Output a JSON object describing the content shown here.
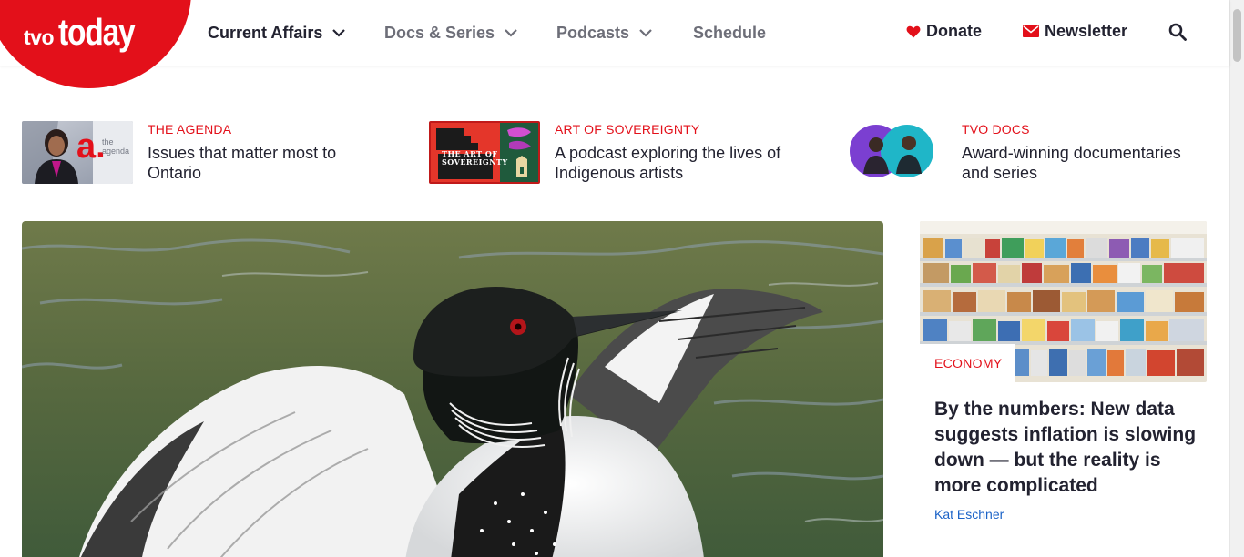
{
  "brand": {
    "tvo": "tvo",
    "today": "today",
    "color": "#e3101a"
  },
  "nav": {
    "items": [
      {
        "label": "Current Affairs",
        "has_dropdown": true,
        "state": "active"
      },
      {
        "label": "Docs & Series",
        "has_dropdown": true,
        "state": "inactive"
      },
      {
        "label": "Podcasts",
        "has_dropdown": true,
        "state": "inactive"
      },
      {
        "label": "Schedule",
        "has_dropdown": false,
        "state": "inactive"
      }
    ],
    "donate": {
      "label": "Donate",
      "icon": "heart-icon"
    },
    "newsletter": {
      "label": "Newsletter",
      "icon": "envelope-icon"
    },
    "search": {
      "icon": "search-icon"
    }
  },
  "promos": [
    {
      "kicker": "THE AGENDA",
      "title": "Issues that matter most to Ontario"
    },
    {
      "kicker": "ART OF SOVEREIGNTY",
      "title": "A podcast exploring the lives of Indigenous artists"
    },
    {
      "kicker": "TVO DOCS",
      "title": "Award-winning documentaries and series"
    }
  ],
  "promo_thumb_text": {
    "agenda_logo": "a.",
    "agenda_small": "the agenda",
    "sovereignty_logo": "THE ART OF SOVEREIGNTY"
  },
  "side_story": {
    "kicker": "ECONOMY",
    "title": "By the numbers: New data suggests inflation is slowing down — but the reality is more complicated",
    "author": "Kat Eschner"
  },
  "colors": {
    "accent": "#e3101a",
    "text": "#222230",
    "muted": "#6d6e78",
    "link": "#1a62c7"
  }
}
